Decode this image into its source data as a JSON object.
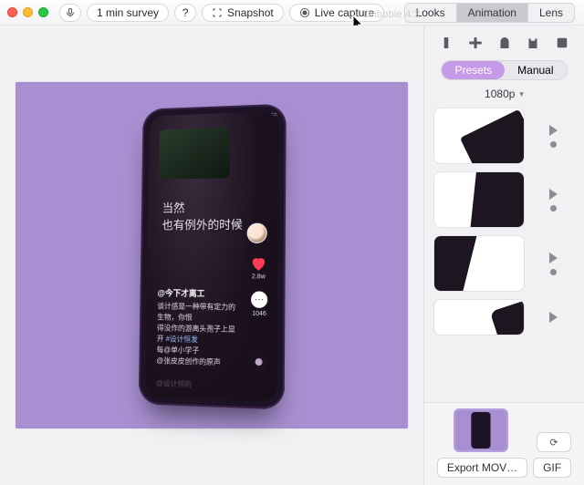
{
  "toolbar": {
    "survey_label": "1 min survey",
    "help_label": "?",
    "snapshot_label": "Snapshot",
    "live_capture_label": "Live capture",
    "tabs": {
      "looks": "Looks",
      "animation": "Animation",
      "lens": "Lens",
      "active": "animation"
    }
  },
  "stage": {
    "watermark": "Dribbble 4:3",
    "bg": "#a88fd1"
  },
  "mockup": {
    "status_icons": [
      "bars",
      "wifi",
      "battery"
    ],
    "headline_line1": "当然",
    "headline_line2": "也有例外的时候",
    "like_count": "2.8w",
    "comment_count": "1046",
    "author": "@今下才离工",
    "caption_1": "谈计感是一种带有定力的生物，你恨",
    "caption_2": "得没作的游离头孢子上显开",
    "hashtag": "#设计恒发",
    "caption_3": "每@单小学子",
    "footer_wm": "@设计师的",
    "marquee": "@张皮皮创作的原声"
  },
  "panel": {
    "preset_tab": "Presets",
    "manual_tab": "Manual",
    "resolution": "1080p",
    "export_label": "Export MOV…",
    "gif_label": "GIF",
    "timer": "⟳"
  }
}
